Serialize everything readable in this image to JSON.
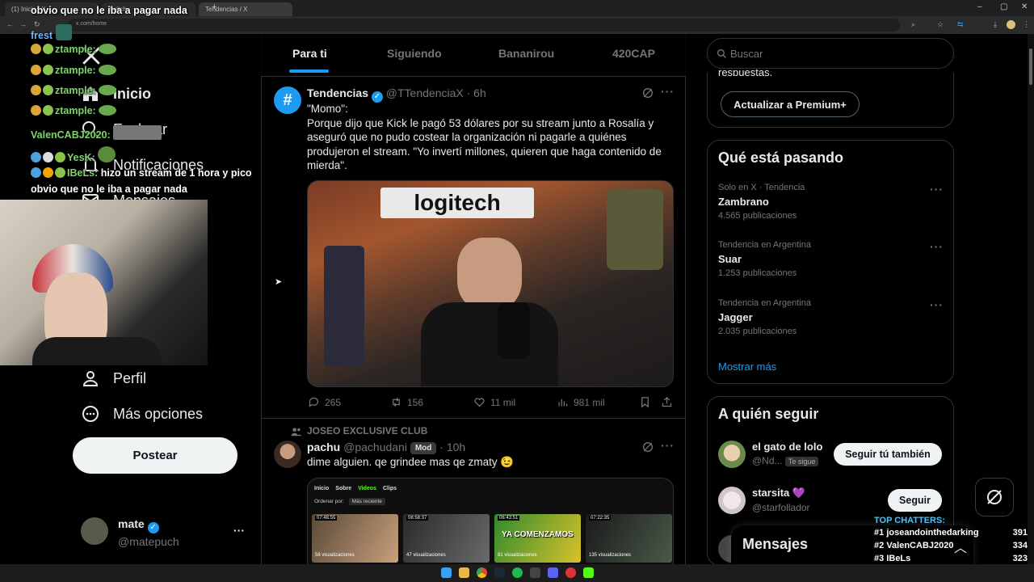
{
  "browser": {
    "tabs": [
      "(1) Inicio / X",
      "Twitch",
      "Tendencias / X"
    ],
    "url": "x.com/home",
    "tab_add": "+",
    "window_controls": [
      "–",
      "▢",
      "✕"
    ]
  },
  "chat_overlay": {
    "top_line": "obvio que no le iba a pagar nada",
    "messages": [
      {
        "user": "frest",
        "text": ""
      },
      {
        "user": "ztample:",
        "text": ""
      },
      {
        "user": "ztample:",
        "text": ""
      },
      {
        "user": "ztample:",
        "text": ""
      },
      {
        "user": "ztample:",
        "text": ""
      },
      {
        "user": "ValenCABJ2020:",
        "text": ""
      },
      {
        "user": "YesK:",
        "text": ""
      },
      {
        "user": "IBeLs:",
        "text": "hizo un stream de 1 hora y pico"
      },
      {
        "user": "",
        "text": "obvio que no le iba a pagar nada"
      }
    ]
  },
  "sidebar": {
    "nav": {
      "inicio": "Inicio",
      "explorar": "Explorar",
      "notificaciones": "Notificaciones",
      "mensajes": "Mensajes",
      "perfil": "Perfil",
      "mas_opciones": "Más opciones"
    },
    "post_button": "Postear",
    "account": {
      "name": "mate",
      "handle": "@matepuch",
      "more": "···"
    }
  },
  "timeline": {
    "tabs": [
      "Para ti",
      "Siguiendo",
      "Bananirou",
      "420CAP"
    ],
    "tweet1": {
      "avatar_glyph": "#",
      "name": "Tendencias",
      "handle": "@TTendenciaX",
      "time": "· 6h",
      "text": "\"Momo\":\nPorque dijo que Kick le pagó 53 dólares por su stream junto a Rosalía y aseguró que no pudo costear la organización ni pagarle a quiénes produjeron el stream. \"Yo invertí millones, quieren que haga contenido de mierda\".",
      "image_sign": "logitech",
      "replies": "265",
      "reposts": "156",
      "likes": "11 mil",
      "views": "981 mil"
    },
    "tweet2": {
      "context": "JOSEO EXCLUSIVE CLUB",
      "name": "pachu",
      "handle": "@pachudani",
      "badge": "Mod",
      "time": "· 10h",
      "text": "dime alguien. qe grindee mas qe zmaty 😉",
      "embed": {
        "nav": [
          "Inicio",
          "Sobre",
          "Videos",
          "Clips"
        ],
        "sort_label": "Ordenar por:",
        "sort_value": "Más reciente",
        "thumbs": [
          {
            "dur": "07:48:55",
            "views": "58 visualizaciones"
          },
          {
            "dur": "08:58:37",
            "views": "47 visualizaciones"
          },
          {
            "dur": "06:43:51",
            "views": "81 visualizaciones",
            "caption": "YA COMENZAMOS"
          },
          {
            "dur": "07:22:35",
            "views": "135 visualizaciones"
          }
        ]
      }
    }
  },
  "right": {
    "search_placeholder": "Buscar",
    "premium_partial": "respuestas.",
    "premium_button": "Actualizar a Premium+",
    "trends_title": "Qué está pasando",
    "trends": [
      {
        "context": "Solo en X · Tendencia",
        "name": "Zambrano",
        "count": "4.565 publicaciones"
      },
      {
        "context": "Tendencia en Argentina",
        "name": "Suar",
        "count": "1.253 publicaciones"
      },
      {
        "context": "Tendencia en Argentina",
        "name": "Jagger",
        "count": "2.035 publicaciones"
      }
    ],
    "show_more": "Mostrar más",
    "follow_title": "A quién seguir",
    "follow": [
      {
        "name": "el gato de lolo",
        "handle": "@Nd...",
        "follows_you": "Te sigue",
        "button": "Seguir tú también"
      },
      {
        "name": "starsita 💜",
        "handle": "@starfollador",
        "button": "Seguir"
      }
    ],
    "messages_drawer": "Mensajes"
  },
  "top_chatters": {
    "header": "TOP CHATTERS:",
    "rows": [
      {
        "rank": "#1",
        "name": "joseandointhedarking",
        "count": "391"
      },
      {
        "rank": "#2",
        "name": "ValenCABJ2020",
        "count": "334"
      },
      {
        "rank": "#3",
        "name": "IBeLs",
        "count": "323"
      }
    ]
  },
  "colors": {
    "accent": "#1d9bf0",
    "background": "#000000",
    "border": "#2f3336",
    "muted": "#71767b"
  }
}
